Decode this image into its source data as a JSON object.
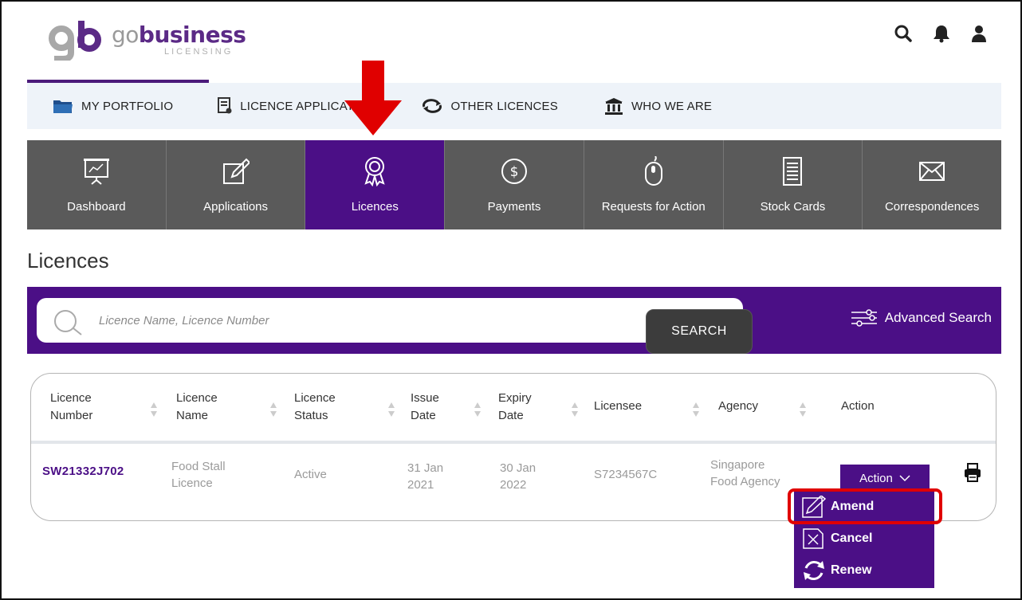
{
  "brand": {
    "logo_mark": "gb",
    "name_prefix": "go",
    "name_suffix": "business",
    "tagline": "LICENSING"
  },
  "header_icons": [
    "search-icon",
    "bell-icon",
    "user-icon"
  ],
  "portfolio_nav": [
    {
      "label": "MY PORTFOLIO",
      "icon": "folder-icon"
    },
    {
      "label": "LICENCE APPLICATION",
      "icon": "document-icon"
    },
    {
      "label": "OTHER LICENCES",
      "icon": "exchange-icon"
    },
    {
      "label": "WHO WE ARE",
      "icon": "institution-icon"
    }
  ],
  "tabs": [
    {
      "label": "Dashboard",
      "icon": "presentation-icon",
      "active": false
    },
    {
      "label": "Applications",
      "icon": "edit-icon",
      "active": false
    },
    {
      "label": "Licences",
      "icon": "award-icon",
      "active": true
    },
    {
      "label": "Payments",
      "icon": "dollar-icon",
      "active": false
    },
    {
      "label": "Requests for Action",
      "icon": "mouse-icon",
      "active": false
    },
    {
      "label": "Stock Cards",
      "icon": "list-document-icon",
      "active": false
    },
    {
      "label": "Correspondences",
      "icon": "envelope-icon",
      "active": false
    }
  ],
  "page_title": "Licences",
  "search": {
    "placeholder": "Licence Name, Licence Number",
    "button_label": "SEARCH",
    "advanced_label": "Advanced Search"
  },
  "table": {
    "columns": [
      {
        "line1": "Licence",
        "line2": "Number"
      },
      {
        "line1": "Licence",
        "line2": "Name"
      },
      {
        "line1": "Licence",
        "line2": "Status"
      },
      {
        "line1": "Issue",
        "line2": "Date"
      },
      {
        "line1": "Expiry",
        "line2": "Date"
      },
      {
        "line1": "Licensee",
        "line2": ""
      },
      {
        "line1": "Agency",
        "line2": ""
      },
      {
        "line1": "Action",
        "line2": ""
      }
    ],
    "rows": [
      {
        "licence_number": "SW21332J702",
        "licence_name_1": "Food Stall",
        "licence_name_2": "Licence",
        "status": "Active",
        "issue_1": "31 Jan",
        "issue_2": "2021",
        "expiry_1": "30 Jan",
        "expiry_2": "2022",
        "licensee": "S7234567C",
        "agency_1": "Singapore",
        "agency_2": "Food Agency",
        "action_label": "Action"
      }
    ]
  },
  "action_menu": [
    {
      "label": "Amend",
      "icon": "pencil-box-icon",
      "highlighted": true
    },
    {
      "label": "Cancel",
      "icon": "x-box-icon",
      "highlighted": false
    },
    {
      "label": "Renew",
      "icon": "refresh-icon",
      "highlighted": false
    }
  ],
  "colors": {
    "brand_purple": "#4b0f86",
    "tab_gray": "#5a5a5a",
    "highlight_red": "#e00000"
  }
}
